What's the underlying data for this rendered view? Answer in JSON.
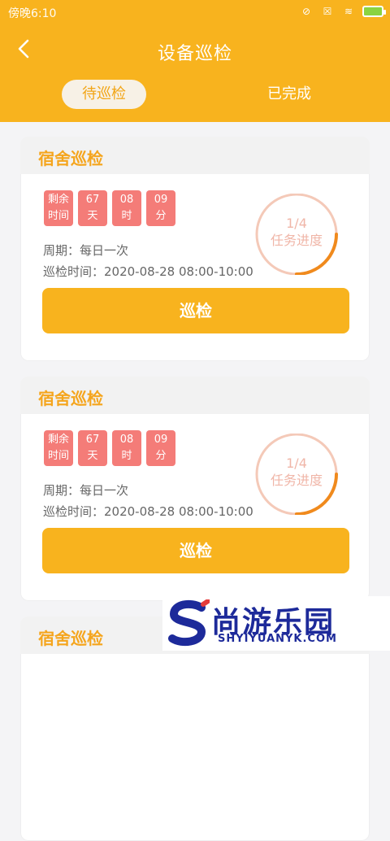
{
  "status": {
    "time": "傍晚6:10",
    "icons": [
      "alarm-off-icon",
      "sim-off-icon",
      "wifi-icon",
      "battery-icon"
    ]
  },
  "nav": {
    "title": "设备巡检"
  },
  "tabs": [
    {
      "label": "待巡检",
      "active": true
    },
    {
      "label": "已完成",
      "active": false
    }
  ],
  "cards": [
    {
      "title": "宿舍巡检",
      "countdown": [
        {
          "top": "剩余",
          "bottom": "时间"
        },
        {
          "top": "67",
          "bottom": "天"
        },
        {
          "top": "08",
          "bottom": "时"
        },
        {
          "top": "09",
          "bottom": "分"
        }
      ],
      "period_label": "周期：每日一次",
      "time_label": "巡检时间：2020-08-28 08:00-10:00",
      "progress_text": "1/4",
      "progress_caption": "任务进度",
      "progress_fraction": 0.25,
      "button_label": "巡检"
    },
    {
      "title": "宿舍巡检",
      "countdown": [
        {
          "top": "剩余",
          "bottom": "时间"
        },
        {
          "top": "67",
          "bottom": "天"
        },
        {
          "top": "08",
          "bottom": "时"
        },
        {
          "top": "09",
          "bottom": "分"
        }
      ],
      "period_label": "周期：每日一次",
      "time_label": "巡检时间：2020-08-28 08:00-10:00",
      "progress_text": "1/4",
      "progress_caption": "任务进度",
      "progress_fraction": 0.25,
      "button_label": "巡检"
    },
    {
      "title": "宿舍巡检"
    }
  ],
  "watermark": {
    "text": "尚游乐园",
    "sub": "SHYIYUANYK.COM"
  },
  "colors": {
    "brand": "#f8b31e",
    "accent": "#f5a51d",
    "countdown_bg": "#f47c78",
    "progress_arc": "#f08a1d",
    "progress_track": "#f4c9b8"
  }
}
